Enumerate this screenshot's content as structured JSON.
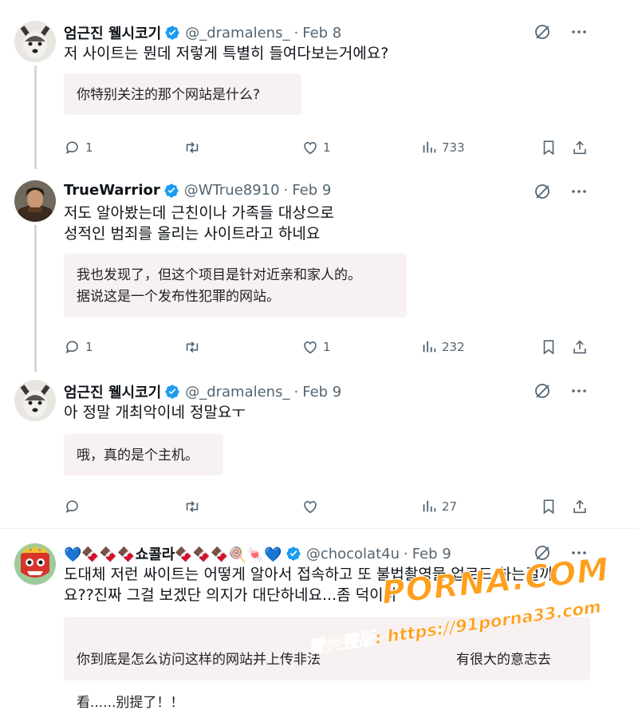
{
  "tweets": [
    {
      "name": "엄근진 웰시코기",
      "handle": "@_dramalens_",
      "date": "Feb 8",
      "text": "저 사이트는 뭔데 저렇게 특별히 들여다보는거에요?",
      "translation": "你特别关注的那个网站是什么?",
      "replies": "1",
      "retweets": "",
      "likes": "1",
      "views": "733"
    },
    {
      "name": "TrueWarrior",
      "handle": "@WTrue8910",
      "date": "Feb 9",
      "text": "저도 알아봤는데 근친이나 가족들 대상으로\n성적인 범죄를 올리는 사이트라고 하네요",
      "translation": "我也发现了，但这个项目是针对近亲和家人的。\n据说这是一个发布性犯罪的网站。",
      "replies": "1",
      "retweets": "",
      "likes": "1",
      "views": "232"
    },
    {
      "name": "엄근진 웰시코기",
      "handle": "@_dramalens_",
      "date": "Feb 9",
      "text": "아 정말 개최악이네 정말요ㅜ",
      "translation": "哦，真的是个主机。",
      "replies": "",
      "retweets": "",
      "likes": "",
      "views": "27"
    },
    {
      "name": "💙🍫🍫🍫쇼콜라🍫🍫🍫🍭🍬💙",
      "handle": "@chocolat4u",
      "date": "Feb 9",
      "text": "도대체 저런 싸이트는 어떻게 알아서 접속하고 또 불법촬영물 업로드 하는걸까\n요??진짜 그걸 보겠단 의지가 대단하네요...좀 덕이바",
      "translation": "你到底是怎么访问这样的网站并上传非法",
      "translation2": "有很大的意志去",
      "translation3": "看......别提了！！"
    }
  ],
  "separator": "·",
  "watermark": {
    "main": "PORNA.COM",
    "sub": "看完整版: https://91porna33.com"
  },
  "colors": {
    "verified": "#1d9bf0",
    "secondary_text": "#536471",
    "translation_bg": "#f7f1f1",
    "watermark": "#ff9f1c"
  }
}
